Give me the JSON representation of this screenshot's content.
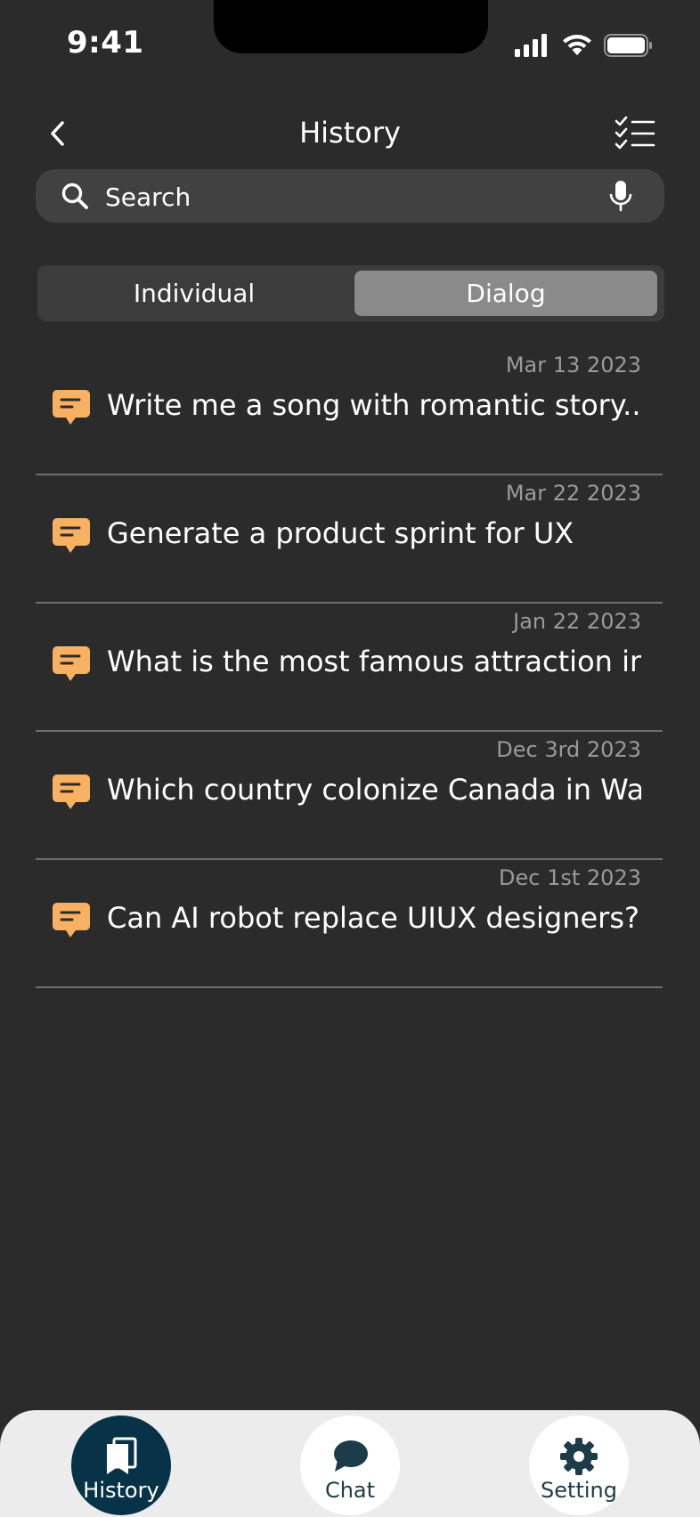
{
  "status_bar": {
    "time": "9:41",
    "icons": [
      "cellular-signal-icon",
      "wifi-icon",
      "battery-icon"
    ]
  },
  "header": {
    "title": "History",
    "back_icon": "chevron-left-icon",
    "action_icon": "checklist-icon"
  },
  "search": {
    "placeholder": "Search",
    "value": "",
    "icon": "search-icon",
    "mic_icon": "microphone-icon"
  },
  "segment": {
    "options": [
      "Individual",
      "Dialog"
    ],
    "selected": "Dialog"
  },
  "history": [
    {
      "date": "Mar 13 2023",
      "text": "Write me a song with romantic story..."
    },
    {
      "date": "Mar 22 2023",
      "text": "Generate a product sprint for UX"
    },
    {
      "date": "Jan 22 2023",
      "text": "What is the most famous attraction in..."
    },
    {
      "date": "Dec 3rd 2023",
      "text": "Which country colonize Canada in War..."
    },
    {
      "date": "Dec 1st 2023",
      "text": "Can AI robot replace UIUX designers?..."
    }
  ],
  "tabbar": {
    "items": [
      {
        "label": "History",
        "icon": "history-book-icon",
        "active": true
      },
      {
        "label": "Chat",
        "icon": "chat-bubble-icon",
        "active": false
      },
      {
        "label": "Setting",
        "icon": "gear-icon",
        "active": false
      }
    ]
  },
  "colors": {
    "background": "#2b2b2b",
    "accent_orange": "#f8b163",
    "active_tab": "#073247",
    "tabbar_background": "#ececec"
  }
}
